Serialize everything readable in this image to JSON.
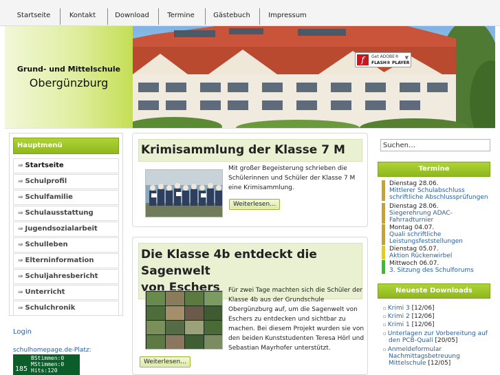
{
  "nav": {
    "items": [
      "Startseite",
      "Kontakt",
      "Download",
      "Termine",
      "Gästebuch",
      "Impressum"
    ]
  },
  "header": {
    "school_line1": "Grund- und Mittelschule",
    "school_line2": "Obergünzburg",
    "flash_badge": {
      "get": "Get ADOBE®",
      "product": "FLASH® PLAYER",
      "logo": "f"
    }
  },
  "sidebar": {
    "menu_title": "Hauptmenü",
    "items": [
      "Startseite",
      "Schulprofil",
      "Schulfamilie",
      "Schulausstattung",
      "Jugendsozialarbeit",
      "Schulleben",
      "Elterninformation",
      "Schuljahresbericht",
      "Unterricht",
      "Schulchronik"
    ],
    "login": "Login",
    "counter_label": "schulhomepage.de-Platz:",
    "counter": {
      "rank": "185",
      "line1": "BStimmen:0",
      "line2": "MStimmen:0",
      "line3": "Hits:120"
    }
  },
  "articles": [
    {
      "title": "Krimisammlung der Klasse 7 M",
      "text_lines": [
        "Mit großer Begeisterung schrieben die",
        "Schülerinnen und Schüler der Klasse 7 M",
        "eine Krimisammlung."
      ],
      "more": "Weiterlesen…"
    },
    {
      "title_lines": [
        "Die Klasse 4b entdeckt die Sagenwelt",
        "von Eschers"
      ],
      "text_lines": [
        "Für zwei Tage machten sich die Schüler der",
        "Klasse 4b aus der Grundschule",
        "Obergünzburg auf, um die Sagenwelt von",
        "Eschers zu entdecken und sichtbar zu",
        "machen. Bei diesem Projekt wurden sie von",
        "den beiden Kunststudenten Teresa Hörl und",
        "Sebastian Mayrhofer unterstützt."
      ],
      "more": "Weiterlesen…"
    }
  ],
  "right": {
    "search_value": "Suchen…",
    "termine_title": "Termine",
    "events": [
      {
        "date": "Dienstag 28.06.",
        "lines": [
          "Mittlerer Schulabschluss",
          "schriftliche Abschlussprüfungen"
        ],
        "color": "#c9a227"
      },
      {
        "date": "Dienstag 28.06.",
        "lines": [
          "Siegerehrung ADAC-",
          "Fahrradturnier"
        ],
        "color": "#c9a227"
      },
      {
        "date": "Montag 04.07.",
        "lines": [
          "Quali schriftliche",
          "Leistungsfeststellungen"
        ],
        "color": "#c9a227"
      },
      {
        "date": "Dienstag 05.07.",
        "lines": [
          "Aktion Rückenwirbel"
        ],
        "color": "#e5d100"
      },
      {
        "date": "Mittwoch 06.07.",
        "lines": [
          "3. Sitzung des Schulforums"
        ],
        "color": "#31c22b"
      }
    ],
    "downloads_title": "Neueste Downloads",
    "downloads": [
      {
        "lines": [
          "Krimi 3"
        ],
        "date": "[12/06]"
      },
      {
        "lines": [
          "Krimi 2"
        ],
        "date": "[12/06]"
      },
      {
        "lines": [
          "Krimi 1"
        ],
        "date": "[12/06]"
      },
      {
        "lines": [
          "Unterlagen zur Vorbereitung auf",
          "den PCB-Quali"
        ],
        "date": "[20/05]"
      },
      {
        "lines": [
          "Anmeldeformular",
          "Nachmittagsbetreuung",
          "Mittelschule"
        ],
        "date": "[12/05]"
      }
    ]
  }
}
